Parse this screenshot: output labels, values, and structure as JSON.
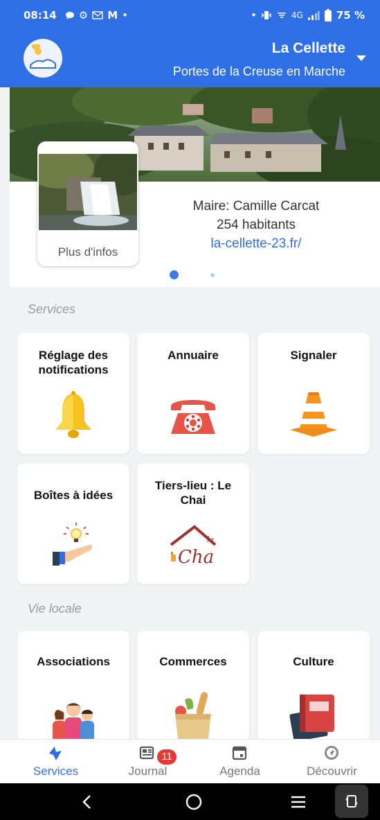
{
  "status_bar": {
    "time": "08:14",
    "mail_glyph": "M",
    "network": "4G",
    "battery": "75 %"
  },
  "header": {
    "town": "La Cellette",
    "region": "Portes de la Creuse en Marche",
    "dropdown_icon": "chevron-down-icon"
  },
  "info": {
    "more_label": "Plus d'infos",
    "mayor": "Maire: Camille Carcat",
    "population": "254 habitants",
    "website": "la-cellette-23.fr/",
    "carousel_pages": 2,
    "carousel_active": 1
  },
  "sections": {
    "services": {
      "title": "Services",
      "tiles": [
        {
          "label": "Réglage des notifications",
          "icon": "bell-icon"
        },
        {
          "label": "Annuaire",
          "icon": "telephone-icon"
        },
        {
          "label": "Signaler",
          "icon": "traffic-cone-icon"
        },
        {
          "label": "Boîtes à idées",
          "icon": "idea-hand-icon"
        },
        {
          "label": "Tiers-lieu : Le Chai",
          "icon": "le-chai-logo"
        }
      ]
    },
    "vie_locale": {
      "title": "Vie locale",
      "tiles": [
        {
          "label": "Associations",
          "icon": "people-icon"
        },
        {
          "label": "Commerces",
          "icon": "grocery-bag-icon"
        },
        {
          "label": "Culture",
          "icon": "books-icon"
        }
      ]
    }
  },
  "bottom_nav": [
    {
      "label": "Services",
      "icon": "services-icon",
      "active": true
    },
    {
      "label": "Journal",
      "icon": "newspaper-icon",
      "badge": "11"
    },
    {
      "label": "Agenda",
      "icon": "calendar-icon"
    },
    {
      "label": "Découvrir",
      "icon": "compass-icon"
    }
  ],
  "system_nav": [
    "back-icon",
    "home-icon",
    "recents-icon",
    "rotate-icon"
  ],
  "colors": {
    "primary": "#2f6fe6",
    "badge": "#e53935",
    "background": "#f2f3f5"
  }
}
